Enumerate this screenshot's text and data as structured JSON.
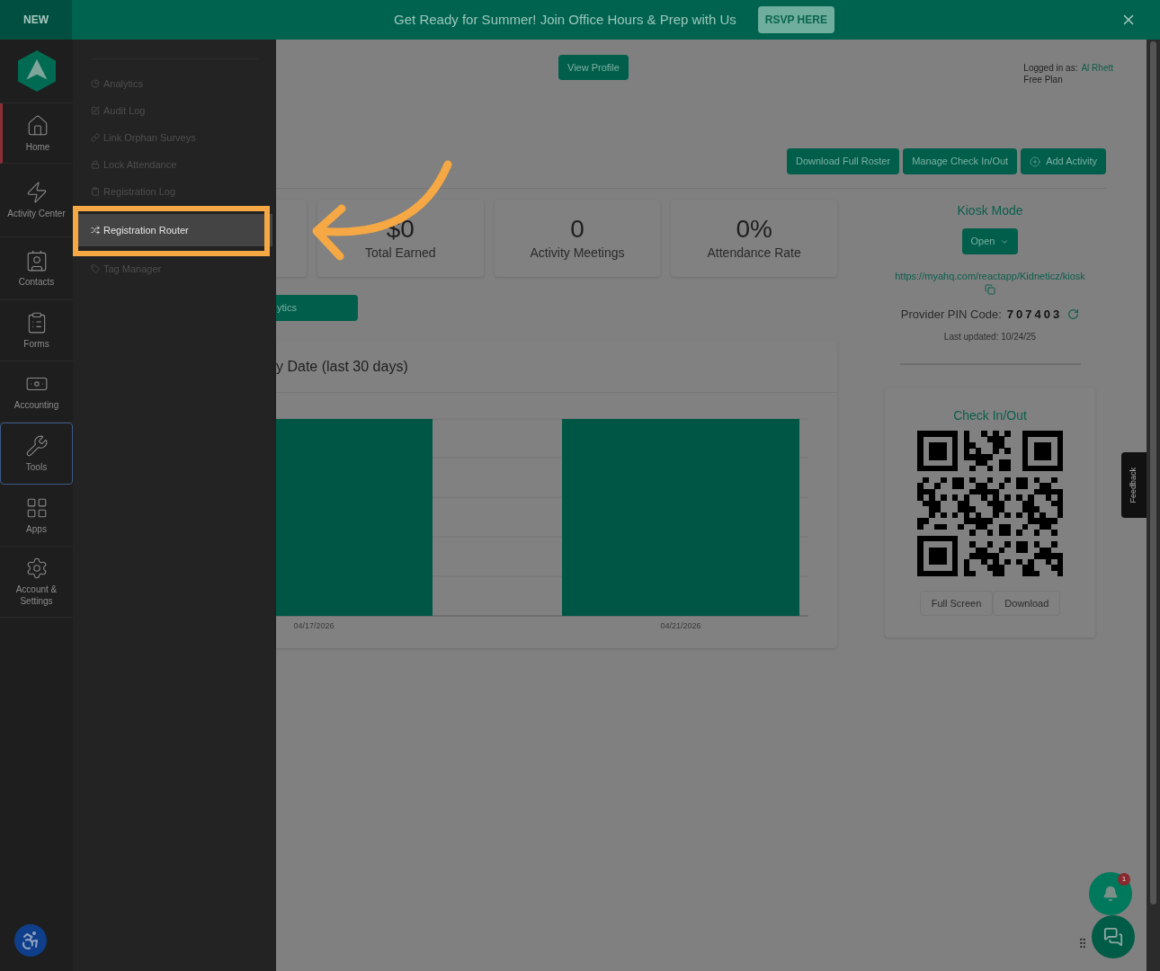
{
  "banner": {
    "tag": "NEW",
    "message": "Get Ready for Summer! Join Office Hours & Prep with Us",
    "button": "RSVP HERE"
  },
  "nav_rail": {
    "items": [
      {
        "label": "Home",
        "selected": true,
        "expanded": false
      },
      {
        "label": "Activity Center",
        "selected": false,
        "expanded": false
      },
      {
        "label": "Contacts",
        "selected": false,
        "expanded": false
      },
      {
        "label": "Forms",
        "selected": false,
        "expanded": false
      },
      {
        "label": "Accounting",
        "selected": false,
        "expanded": false
      },
      {
        "label": "Tools",
        "selected": false,
        "expanded": true
      },
      {
        "label": "Apps",
        "selected": false,
        "expanded": false
      },
      {
        "label": "Account & Settings",
        "selected": false,
        "expanded": false
      }
    ]
  },
  "tools_menu": {
    "items": [
      {
        "label": "Analytics",
        "selected": false
      },
      {
        "label": "Audit Log",
        "selected": false
      },
      {
        "label": "Link Orphan Surveys",
        "selected": false
      },
      {
        "label": "Lock Attendance",
        "selected": false
      },
      {
        "label": "Registration Log",
        "selected": false
      },
      {
        "label": "Registration Router",
        "selected": true
      },
      {
        "label": "Tag Manager",
        "selected": false
      }
    ]
  },
  "header": {
    "view_profile": "View Profile",
    "logged_in_label": "Logged in as:",
    "user": "Al Rhett",
    "plan": "Free Plan"
  },
  "actions": [
    {
      "label": "Download Full Roster",
      "kind": "plain"
    },
    {
      "label": "Manage Check In/Out",
      "kind": "plain"
    },
    {
      "label": "Add Activity",
      "kind": "add"
    }
  ],
  "stats": [
    {
      "value": "$0",
      "label": "Total Earned"
    },
    {
      "value": "0",
      "label": "Activity Meetings"
    },
    {
      "value": "0%",
      "label": "Attendance Rate"
    }
  ],
  "analytics_button": "ytics",
  "chart": {
    "title": "y Date (last 30 days)",
    "x_labels": [
      "04/17/2026",
      "04/21/2026"
    ]
  },
  "kiosk": {
    "title": "Kiosk Mode",
    "button": "Open",
    "url": "https://myahq.com/reactapp/Kidneticz/kiosk",
    "pin_label": "Provider PIN Code:",
    "pin": "707403",
    "updated": "Last updated: 10/24/25"
  },
  "check_in": {
    "title": "Check In/Out",
    "buttons": [
      "Full Screen",
      "Download"
    ]
  },
  "feedback": "Feedback",
  "notifications": {
    "count": "1"
  }
}
